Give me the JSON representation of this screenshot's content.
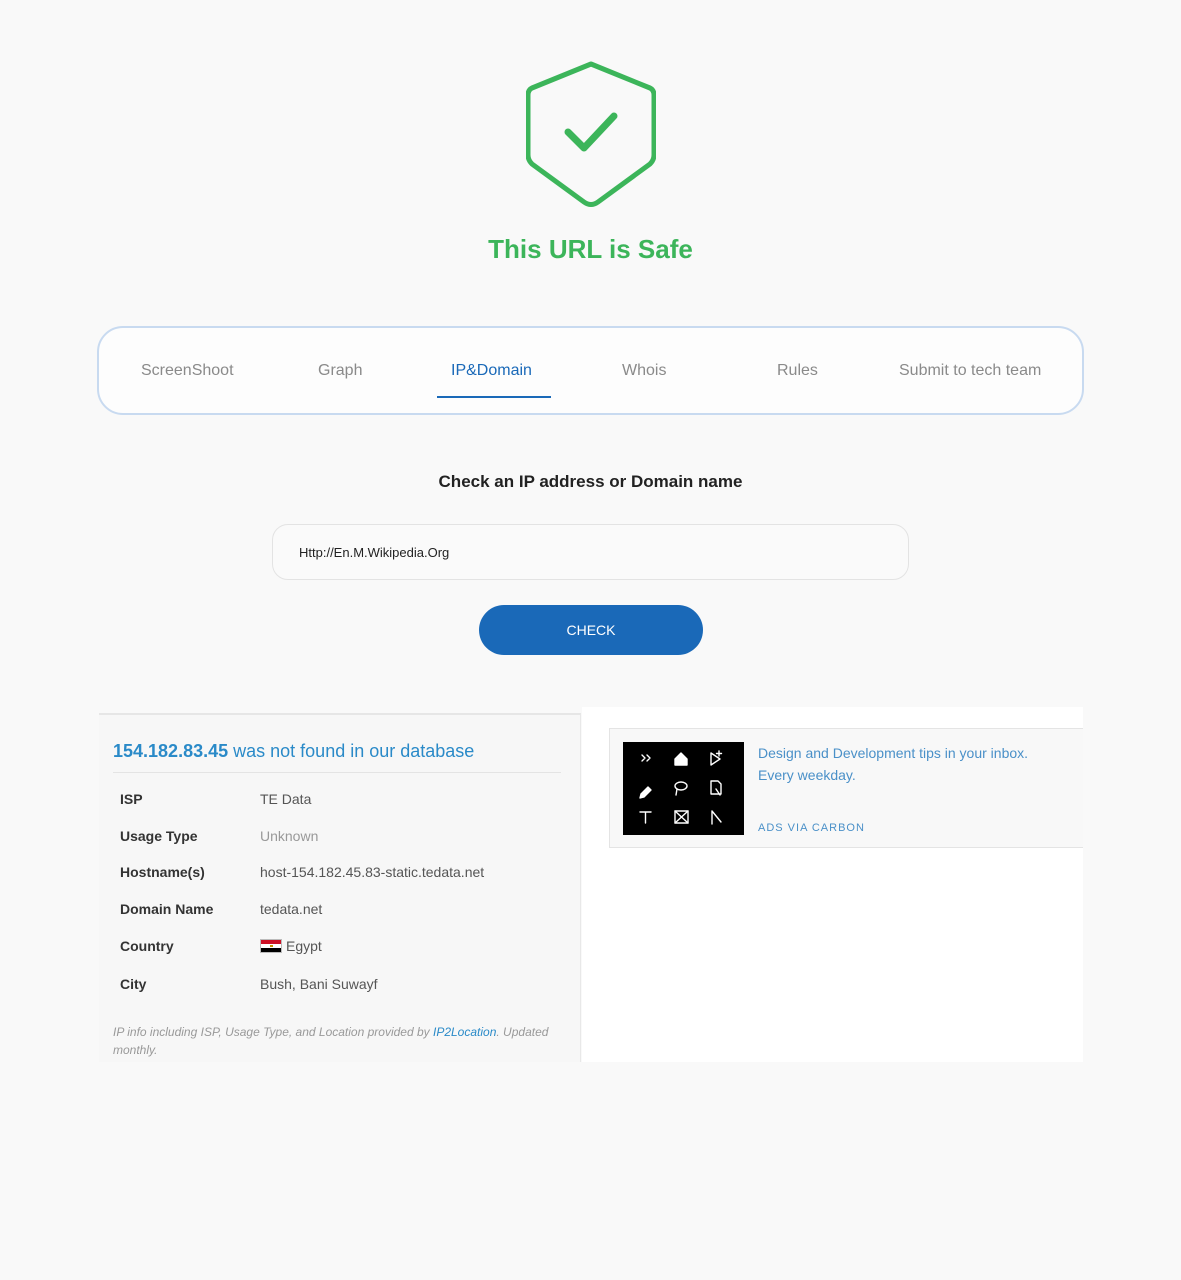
{
  "status": {
    "title": "This URL is Safe",
    "accent_color": "#3cb55a",
    "icon": "shield-check-icon"
  },
  "tabs": [
    {
      "label": "ScreenShoot",
      "active": false
    },
    {
      "label": "Graph",
      "active": false
    },
    {
      "label": "IP&Domain",
      "active": true
    },
    {
      "label": "Whois",
      "active": false
    },
    {
      "label": "Rules",
      "active": false
    },
    {
      "label": "Submit to tech team",
      "active": false
    }
  ],
  "checker": {
    "heading": "Check an IP address or Domain name",
    "input_value": "Http://En.M.Wikipedia.Org",
    "button_label": "CHECK",
    "button_color": "#1a69b8"
  },
  "ip_info": {
    "ip": "154.182.83.45",
    "not_found_text": "was not found in our database",
    "rows": [
      {
        "label": "ISP",
        "value": "TE Data"
      },
      {
        "label": "Usage Type",
        "value": "Unknown"
      },
      {
        "label": "Hostname(s)",
        "value": "host-154.182.45.83-static.tedata.net"
      },
      {
        "label": "Domain Name",
        "value": "tedata.net"
      },
      {
        "label": "Country",
        "value": "Egypt",
        "flag": "egypt-flag-icon"
      },
      {
        "label": "City",
        "value": "Bush, Bani Suwayf"
      }
    ],
    "note_prefix": "IP info including ISP, Usage Type, and Location provided by",
    "note_link": "IP2Location",
    "note_suffix": ". Updated monthly."
  },
  "ad": {
    "text": "Design and Development tips in your inbox. Every weekday.",
    "via": "ADS VIA CARBON",
    "image_icons": [
      "chevrons-right-icon",
      "home-icon",
      "cursor-plus-icon",
      "pen-icon",
      "lasso-icon",
      "file-cursor-icon",
      "text-tool-icon",
      "frame-icon",
      "corner-icon"
    ]
  }
}
